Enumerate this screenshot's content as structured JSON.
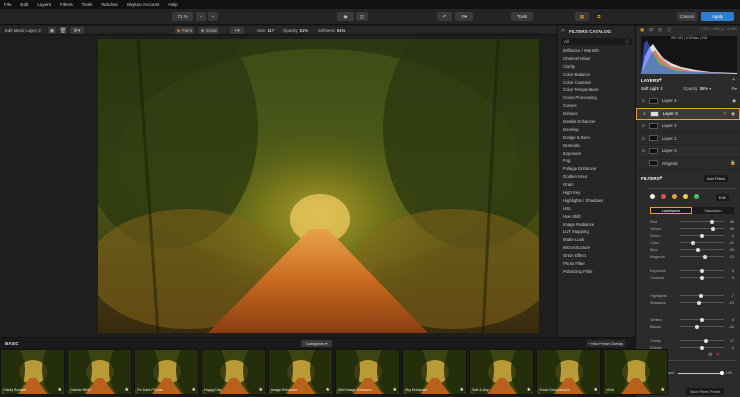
{
  "menu": [
    "File",
    "Edit",
    "Layers",
    "Filters",
    "Tools",
    "Window",
    "Skylum Account",
    "Help"
  ],
  "toolbar": {
    "zoom": "71 %",
    "tools": "Tools",
    "cancel": "Cancel",
    "apply": "Apply"
  },
  "layerbar": {
    "layer_name": "Edit Mask: Layer 3",
    "paint": "Paint",
    "erase": "Erase",
    "size_label": "Size",
    "size_value": "117",
    "opacity_label": "Opacity",
    "opacity_value": "51%",
    "softness_label": "Softness",
    "softness_value": "61%"
  },
  "catalog": {
    "title": "FILTERS CATALOG",
    "filter": "All",
    "items": [
      "Brilliance / Warmth",
      "Channel Mixer",
      "Clarity",
      "Color Balance",
      "Color Contrast",
      "Color Temperature",
      "Cross Processing",
      "Curves",
      "Dehaze",
      "Details Enhancer",
      "Develop",
      "Dodge & Burn",
      "Dramatic",
      "Exposure",
      "Fog",
      "Foliage Enhancer",
      "Golden Hour",
      "Grain",
      "High Key",
      "Highlights / Shadows",
      "HSL",
      "Hue Shift",
      "Image Radiance",
      "LUT Mapping",
      "Matte Look",
      "Microstructure",
      "Orton Effect",
      "Photo Filter",
      "Polarizing Filter"
    ]
  },
  "info": {
    "dims": "6712 × 4480 px · 24 bits",
    "exif": "ISO 100 | 1/100sec | f/18"
  },
  "layers": {
    "title": "LAYERS",
    "blend": "Soft Light",
    "opacity_label": "Opacity:",
    "opacity_value": "65%",
    "items": [
      "Layer 4",
      "Layer 3",
      "Layer 2",
      "Layer 1",
      "Layer 0",
      "Original"
    ]
  },
  "filters": {
    "title": "FILTERS",
    "add": "Add Filters",
    "edit": "Edit",
    "swatches": [
      "#f0f0f0",
      "#e05050",
      "#e8a040",
      "#e8d040",
      "#50c060"
    ],
    "tab_luminance": "Luminance",
    "tab_saturation": "Saturation",
    "sliders1": [
      {
        "label": "Red",
        "value": "46",
        "pos": 0.73
      },
      {
        "label": "Yellow",
        "value": "49",
        "pos": 0.74
      },
      {
        "label": "Green",
        "value": "0",
        "pos": 0.5
      },
      {
        "label": "Cyan",
        "value": "-41",
        "pos": 0.3
      },
      {
        "label": "Blue",
        "value": "-20",
        "pos": 0.4
      },
      {
        "label": "Magenta",
        "value": "13",
        "pos": 0.56
      }
    ],
    "sliders2": [
      {
        "label": "Exposure",
        "value": "0",
        "pos": 0.5
      },
      {
        "label": "Contrast",
        "value": "0",
        "pos": 0.5
      }
    ],
    "sliders3": [
      {
        "label": "Highlights",
        "value": "-7",
        "pos": 0.47
      },
      {
        "label": "Shadows",
        "value": "-13",
        "pos": 0.44
      }
    ],
    "sliders4": [
      {
        "label": "Whites",
        "value": "0",
        "pos": 0.5
      },
      {
        "label": "Blacks",
        "value": "-24",
        "pos": 0.38
      }
    ],
    "sliders5": [
      {
        "label": "Clarity",
        "value": "17",
        "pos": 0.58
      },
      {
        "label": "Details",
        "value": "0",
        "pos": 0.5
      }
    ],
    "amount_label": "Filters Amount",
    "amount_value": "100",
    "save": "Save Filters Preset"
  },
  "strip": {
    "section": "BASIC",
    "categories": "Categories",
    "new_preset": "+ New Preset Overlay",
    "presets": [
      "Clarity Booster",
      "Classic B&W",
      "Fix Dark Photos",
      "Happy Day",
      "Image Enhancer",
      "Mild Image Enhancer",
      "Sky Enhancer",
      "Soft & Airy",
      "Tonal Compression",
      "Vivid"
    ]
  },
  "colors": {
    "accent": "#2d7fd3",
    "active_tab": "#f0a020"
  }
}
